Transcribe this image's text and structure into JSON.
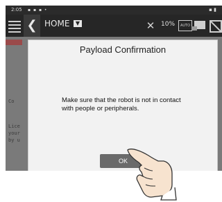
{
  "status_bar": {
    "time": "2:05",
    "notifications": "▪ ▪ ▪ •",
    "right_indicators": "▪ ▮"
  },
  "header": {
    "title": "HOME",
    "caret_symbol": "▼",
    "back_symbol": "❮",
    "speed": "10%",
    "auto_label": "AUTO"
  },
  "background": {
    "fragment_1": "Co",
    "fragment_2": "Lice\nyour\nby u"
  },
  "dialog": {
    "title": "Payload Confirmation",
    "message": "Make sure that the robot is not in contact\nwith people or peripherals.",
    "ok_label": "OK"
  },
  "colors": {
    "header_bg": "#262626",
    "dialog_bg": "#f2f2f2",
    "ok_button": "#6a6a6a"
  }
}
